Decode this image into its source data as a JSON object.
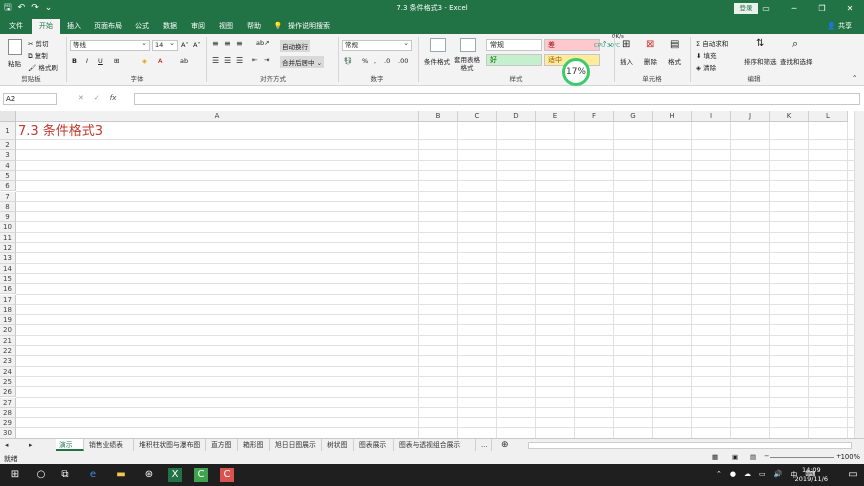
{
  "window": {
    "title": "7.3 条件格式3 - Excel",
    "login": "登录",
    "share": "共享"
  },
  "tabs": [
    "文件",
    "开始",
    "插入",
    "页面布局",
    "公式",
    "数据",
    "审阅",
    "视图",
    "帮助",
    "操作说明搜索"
  ],
  "ribbon": {
    "clipboard": {
      "label": "剪贴板",
      "paste": "粘贴",
      "cut": "剪切",
      "copy": "复制",
      "format_painter": "格式刷"
    },
    "font": {
      "label": "字体",
      "name": "等线",
      "size": "14"
    },
    "alignment": {
      "label": "对齐方式",
      "wrap": "自动换行",
      "merge": "合并后居中"
    },
    "number": {
      "label": "数字",
      "format": "常规"
    },
    "styles": {
      "label": "样式",
      "cond_format": "条件格式",
      "table_format": "套用表格格式",
      "normal": "常规",
      "bad": "差",
      "good": "好",
      "neutral": "适中"
    },
    "cells": {
      "label": "单元格",
      "insert": "插入",
      "delete": "删除",
      "format": "格式"
    },
    "editing": {
      "label": "编辑",
      "autosum": "自动求和",
      "fill": "填充",
      "clear": "清除",
      "sort": "排序和筛选",
      "find": "查找和选择"
    },
    "cpu": {
      "percent": "17%",
      "cpu_label": "CPU 30℃",
      "net": "0K/s"
    }
  },
  "formula_bar": {
    "namebox": "A2",
    "fx": "fx"
  },
  "columns": [
    "A",
    "B",
    "C",
    "D",
    "E",
    "F",
    "G",
    "H",
    "I",
    "J",
    "K",
    "L"
  ],
  "rows": [
    "1",
    "2",
    "3",
    "4",
    "5",
    "6",
    "7",
    "8",
    "9",
    "10",
    "11",
    "12",
    "13",
    "14",
    "15",
    "16",
    "17",
    "18",
    "19",
    "20",
    "21",
    "22",
    "23",
    "24",
    "25",
    "26",
    "27",
    "28",
    "29",
    "30"
  ],
  "cell_a1": "7.3 条件格式3",
  "sheets": [
    "演示",
    "销售业绩表",
    "堆积柱状图与瀑布图",
    "直方图",
    "箱形图",
    "旭日日图展示",
    "树状图",
    "图表展示",
    "图表与透视组合展示",
    "..."
  ],
  "status": {
    "ready": "就绪",
    "zoom": "100%"
  },
  "taskbar": {
    "time": "14:09",
    "date": "2019/11/6",
    "ime": "中"
  }
}
